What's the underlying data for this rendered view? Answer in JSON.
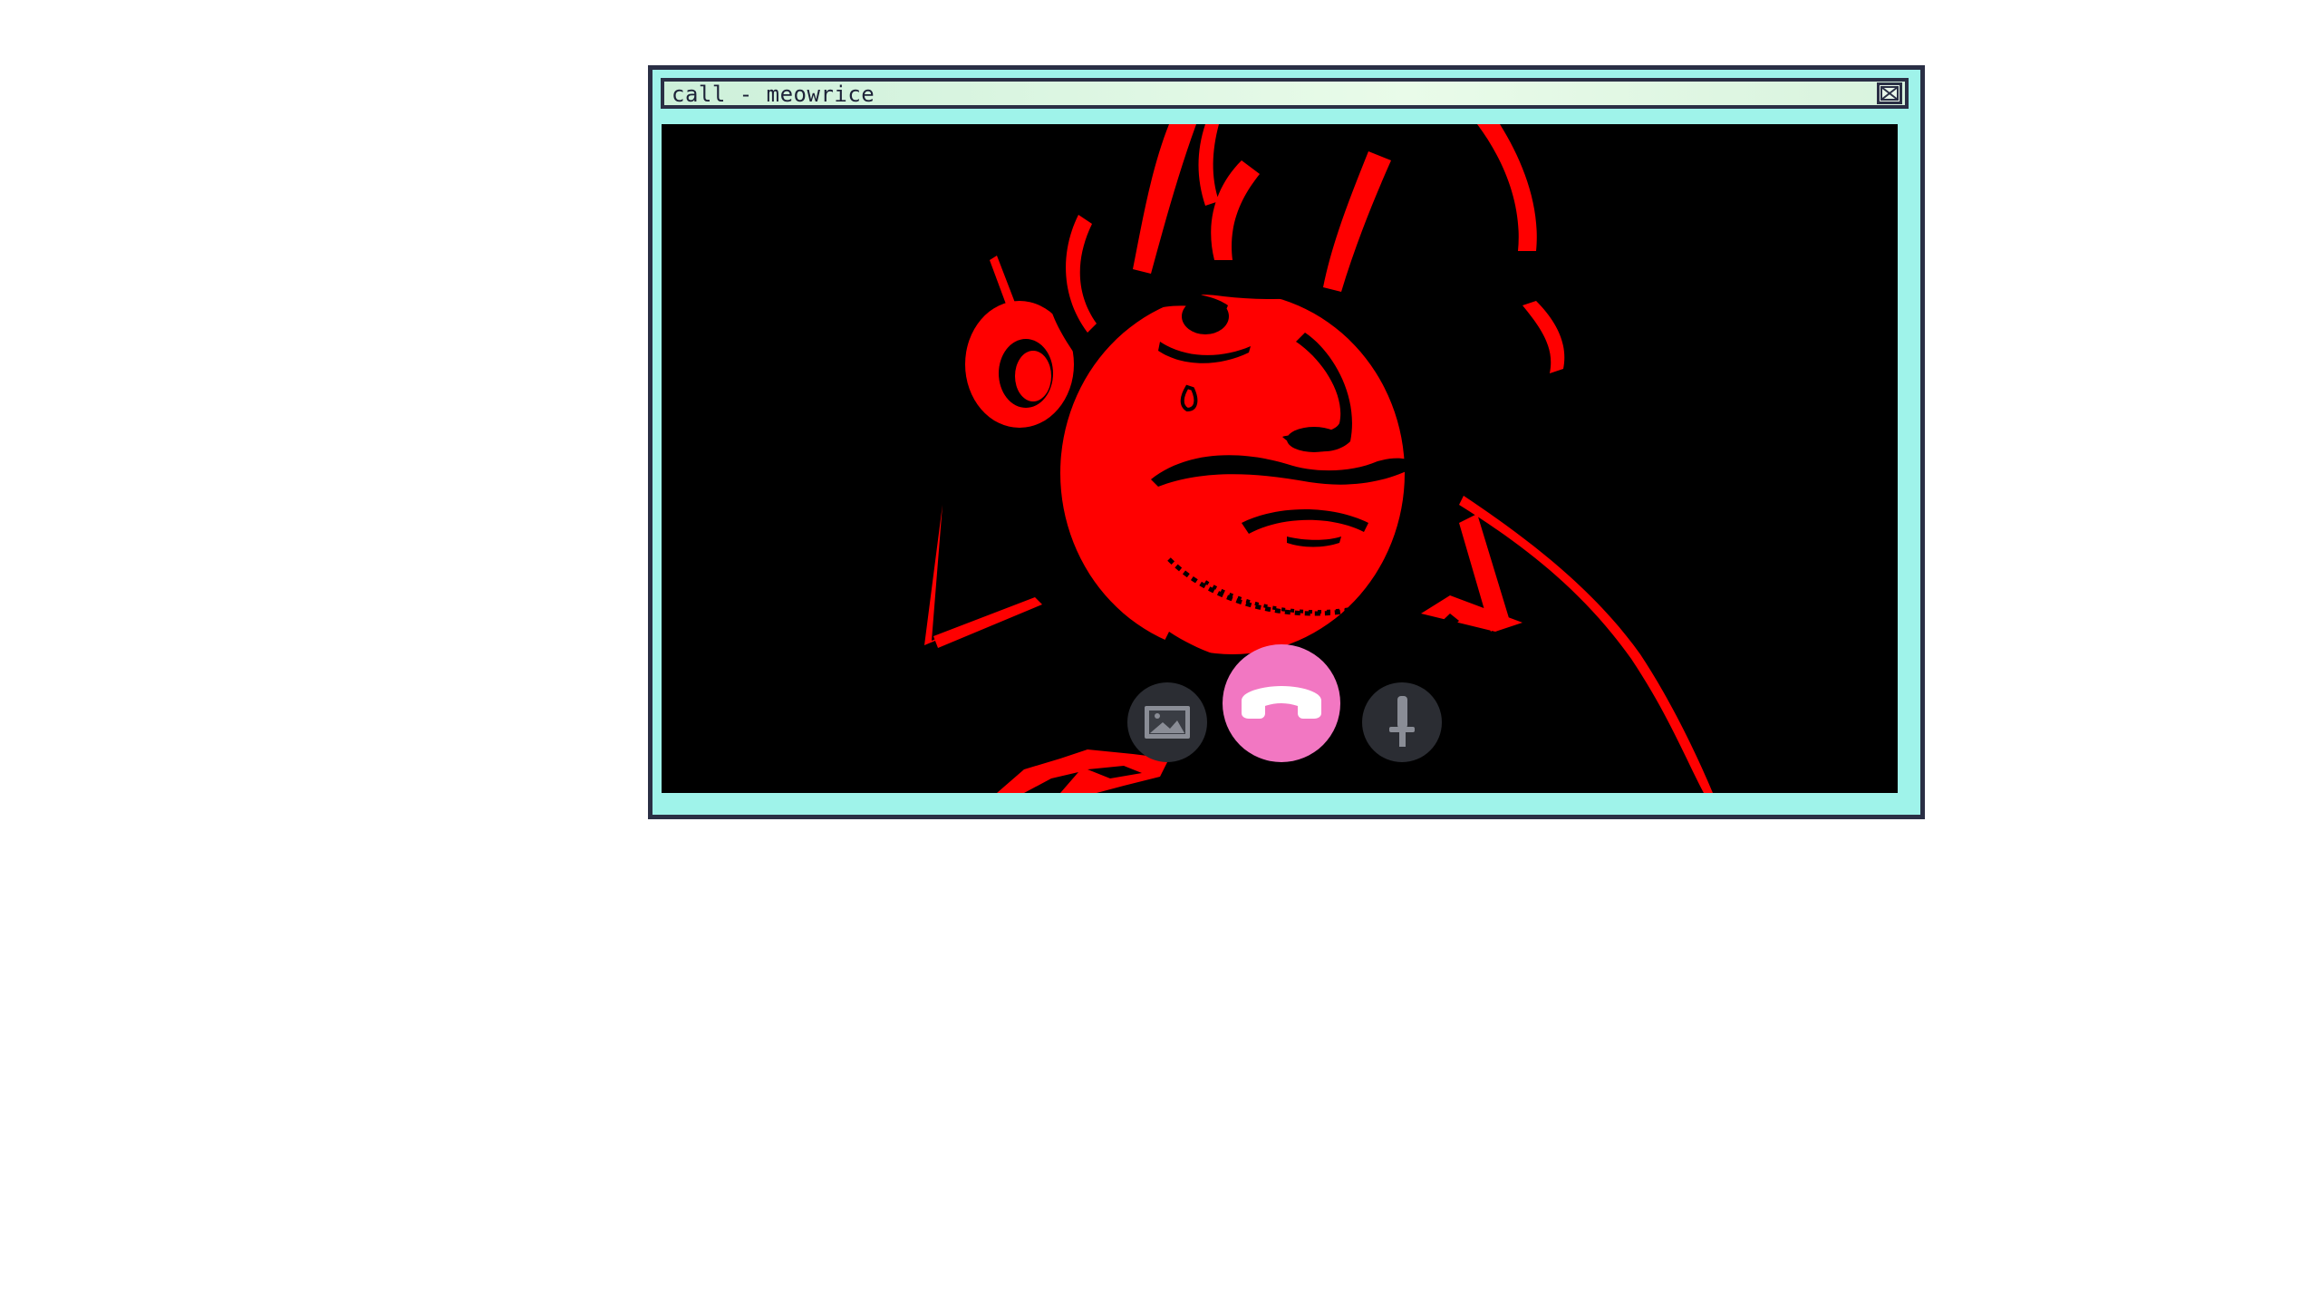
{
  "window": {
    "title": "call - meowrice"
  },
  "icons": {
    "close": "close-icon",
    "image": "image-icon",
    "hangup": "phone-hangup-icon",
    "mic": "microphone-icon"
  },
  "colors": {
    "window_frame": "#2a2f45",
    "window_bg": "#9ff3ea",
    "titlebar_bg": "#e9fbe9",
    "video_bg": "#000000",
    "caller_art": "#ff0000",
    "hangup_button": "#f277c2",
    "control_button": "#2b2d33"
  }
}
